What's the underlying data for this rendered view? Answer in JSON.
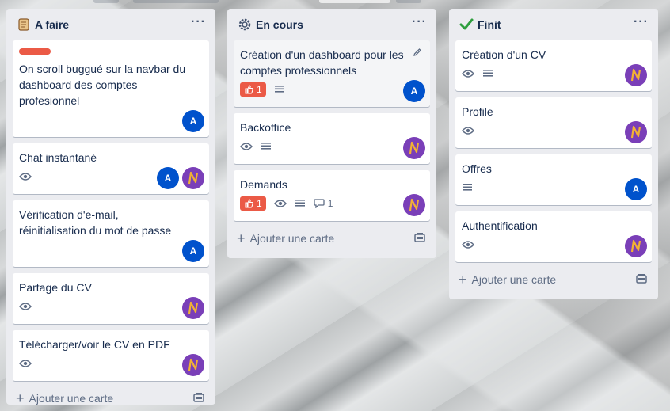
{
  "lists": [
    {
      "title": "A faire",
      "add_label": "Ajouter une carte",
      "cards": [
        {
          "title": "On scroll buggué sur la navbar du dashboard des comptes profesionnel",
          "member": "A"
        },
        {
          "title": "Chat instantané",
          "member": "A"
        },
        {
          "title": "Vérification d'e-mail, réinitialisation du mot de passe",
          "member": "A"
        },
        {
          "title": "Partage du CV"
        },
        {
          "title": "Télécharger/voir le CV en PDF"
        }
      ]
    },
    {
      "title": "En cours",
      "add_label": "Ajouter une carte",
      "cards": [
        {
          "title": "Création d'un dashboard pour les comptes professionnels",
          "votes": "1",
          "member": "A"
        },
        {
          "title": "Backoffice"
        },
        {
          "title": "Demands",
          "votes": "1",
          "comments": "1"
        }
      ]
    },
    {
      "title": "Finit",
      "add_label": "Ajouter une carte",
      "cards": [
        {
          "title": "Création d'un CV"
        },
        {
          "title": "Profile"
        },
        {
          "title": "Offres",
          "member": "A"
        },
        {
          "title": "Authentification"
        }
      ]
    }
  ],
  "colors": {
    "accent": "#0052cc",
    "label_red": "#eb5a46",
    "list_bg": "#ebecf0"
  }
}
